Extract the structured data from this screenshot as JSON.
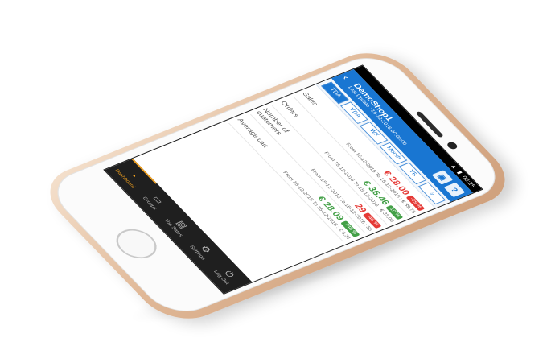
{
  "status_bar": {
    "time": "08:25"
  },
  "header": {
    "title": "DemoShop1",
    "last_update": "Last Update : 15-12-2016 00:00:00",
    "buttons": [
      {
        "icon": "save-icon",
        "label": "▣"
      },
      {
        "icon": "help-icon",
        "label": "?"
      }
    ]
  },
  "tabs": [
    {
      "label": "TDA",
      "active": true
    },
    {
      "label": "YDA",
      "active": false
    },
    {
      "label": "WK",
      "active": false
    },
    {
      "label": "Month",
      "active": false
    },
    {
      "label": "YR",
      "active": false
    },
    {
      "label": "⊙",
      "active": false
    }
  ],
  "kpis": [
    {
      "label": "Sales",
      "value": "€ 28.00",
      "value_color": "red",
      "badge": "-29 %",
      "badge_color": "red",
      "sub": "From 15-12-2015 To 15-12-2016 : € 39,75"
    },
    {
      "label": "Orders",
      "value": "€ 36.46",
      "value_color": "green",
      "badge": "10 %",
      "badge_color": "green",
      "sub": "From 15-12-2015 To 15-12-2016 : € 33,09"
    },
    {
      "label": "Number of customers",
      "value": "29",
      "value_color": "red",
      "badge": "-48 %",
      "badge_color": "red",
      "sub": "From 15-12-2015 To 15-12-2016 : 56"
    },
    {
      "label": "Average cart",
      "value": "€ 28.09",
      "value_color": "green",
      "badge": "748 %",
      "badge_color": "green",
      "sub": "From 15-12-2015 To 15-12-2016 : € 3,31"
    }
  ],
  "bottom_nav": [
    {
      "label": "Dashboard",
      "icon": "dashboard-icon",
      "glyph": "◔",
      "active": true
    },
    {
      "label": "Groups",
      "icon": "groups-icon",
      "glyph": "▭",
      "active": false
    },
    {
      "label": "Top Sales",
      "icon": "top-sales-icon",
      "glyph": "▤",
      "active": false
    },
    {
      "label": "Settings",
      "icon": "gear-icon",
      "glyph": "⚙",
      "active": false
    },
    {
      "label": "Log Out",
      "icon": "logout-icon",
      "glyph": "⏻",
      "active": false
    }
  ]
}
